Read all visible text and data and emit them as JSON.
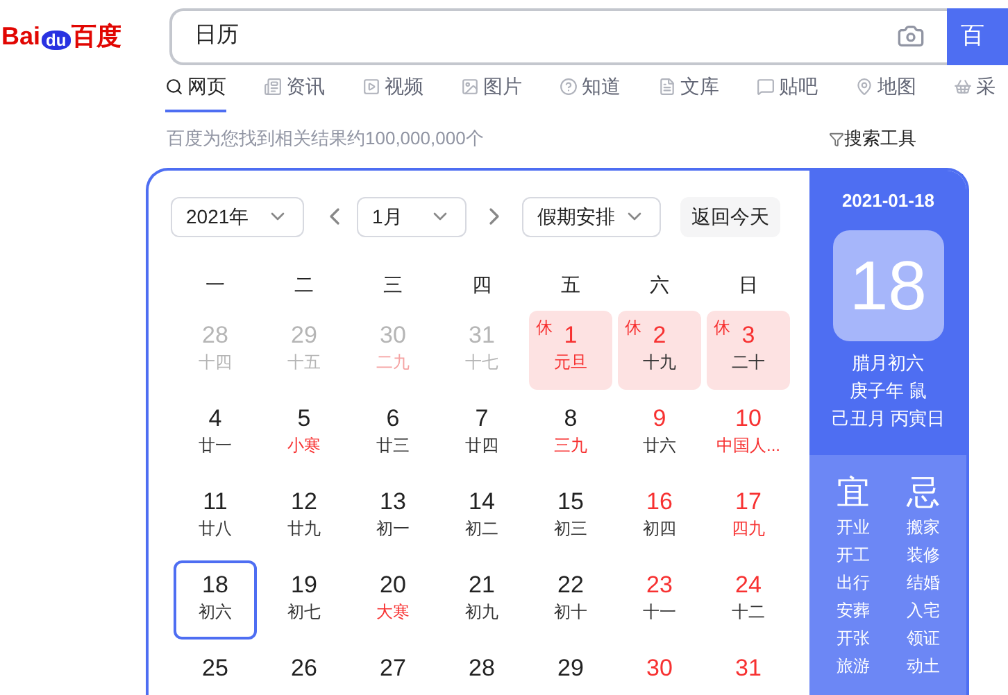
{
  "logo": {
    "left": "Bai",
    "paw": "du",
    "right": "百度"
  },
  "search": {
    "value": "日历",
    "button": "百"
  },
  "tabs": [
    {
      "label": "网页",
      "selected": true,
      "kind": "search"
    },
    {
      "label": "资讯",
      "selected": false,
      "kind": "news"
    },
    {
      "label": "视频",
      "selected": false,
      "kind": "video"
    },
    {
      "label": "图片",
      "selected": false,
      "kind": "image"
    },
    {
      "label": "知道",
      "selected": false,
      "kind": "question"
    },
    {
      "label": "文库",
      "selected": false,
      "kind": "doc"
    },
    {
      "label": "贴吧",
      "selected": false,
      "kind": "forum"
    },
    {
      "label": "地图",
      "selected": false,
      "kind": "map"
    },
    {
      "label": "采",
      "selected": false,
      "kind": "shop"
    }
  ],
  "result_count": "百度为您找到相关结果约100,000,000个",
  "search_tools": "搜索工具",
  "calendar": {
    "year": "2021年",
    "month": "1月",
    "holiday_select": "假期安排",
    "today_button": "返回今天",
    "weekdays": [
      "一",
      "二",
      "三",
      "四",
      "五",
      "六",
      "日"
    ],
    "days": [
      {
        "day": "28",
        "lunar": "十四",
        "other_month": true,
        "festival": false,
        "selected": false
      },
      {
        "day": "29",
        "lunar": "十五",
        "other_month": true,
        "festival": false,
        "selected": false
      },
      {
        "day": "30",
        "lunar": "二九",
        "other_month": true,
        "festival": true,
        "selected": false
      },
      {
        "day": "31",
        "lunar": "十七",
        "other_month": true,
        "festival": false,
        "selected": false
      },
      {
        "day": "1",
        "lunar": "元旦",
        "rest_label": "休",
        "other_month": false,
        "red": true,
        "festival": true,
        "selected": false
      },
      {
        "day": "2",
        "lunar": "十九",
        "rest_label": "休",
        "other_month": false,
        "red": true,
        "festival": false,
        "selected": false
      },
      {
        "day": "3",
        "lunar": "二十",
        "rest_label": "休",
        "other_month": false,
        "red": true,
        "festival": false,
        "selected": false
      },
      {
        "day": "4",
        "lunar": "廿一",
        "other_month": false,
        "red": false,
        "festival": false,
        "selected": false
      },
      {
        "day": "5",
        "lunar": "小寒",
        "other_month": false,
        "red": false,
        "festival": true,
        "selected": false
      },
      {
        "day": "6",
        "lunar": "廿三",
        "other_month": false,
        "red": false,
        "festival": false,
        "selected": false
      },
      {
        "day": "7",
        "lunar": "廿四",
        "other_month": false,
        "red": false,
        "festival": false,
        "selected": false
      },
      {
        "day": "8",
        "lunar": "三九",
        "other_month": false,
        "red": false,
        "festival": true,
        "selected": false
      },
      {
        "day": "9",
        "lunar": "廿六",
        "other_month": false,
        "red": true,
        "festival": false,
        "selected": false
      },
      {
        "day": "10",
        "lunar": "中国人...",
        "other_month": false,
        "red": true,
        "festival": true,
        "selected": false
      },
      {
        "day": "11",
        "lunar": "廿八",
        "other_month": false,
        "red": false,
        "festival": false,
        "selected": false
      },
      {
        "day": "12",
        "lunar": "廿九",
        "other_month": false,
        "red": false,
        "festival": false,
        "selected": false
      },
      {
        "day": "13",
        "lunar": "初一",
        "other_month": false,
        "red": false,
        "festival": false,
        "selected": false
      },
      {
        "day": "14",
        "lunar": "初二",
        "other_month": false,
        "red": false,
        "festival": false,
        "selected": false
      },
      {
        "day": "15",
        "lunar": "初三",
        "other_month": false,
        "red": false,
        "festival": false,
        "selected": false
      },
      {
        "day": "16",
        "lunar": "初四",
        "other_month": false,
        "red": true,
        "festival": false,
        "selected": false
      },
      {
        "day": "17",
        "lunar": "四九",
        "other_month": false,
        "red": true,
        "festival": true,
        "selected": false
      },
      {
        "day": "18",
        "lunar": "初六",
        "other_month": false,
        "red": false,
        "festival": false,
        "selected": true
      },
      {
        "day": "19",
        "lunar": "初七",
        "other_month": false,
        "red": false,
        "festival": false,
        "selected": false
      },
      {
        "day": "20",
        "lunar": "大寒",
        "other_month": false,
        "red": false,
        "festival": true,
        "selected": false
      },
      {
        "day": "21",
        "lunar": "初九",
        "other_month": false,
        "red": false,
        "festival": false,
        "selected": false
      },
      {
        "day": "22",
        "lunar": "初十",
        "other_month": false,
        "red": false,
        "festival": false,
        "selected": false
      },
      {
        "day": "23",
        "lunar": "十一",
        "other_month": false,
        "red": true,
        "festival": false,
        "selected": false
      },
      {
        "day": "24",
        "lunar": "十二",
        "other_month": false,
        "red": true,
        "festival": false,
        "selected": false
      },
      {
        "day": "25",
        "other_month": false,
        "red": false,
        "selected": false
      },
      {
        "day": "26",
        "other_month": false,
        "red": false,
        "selected": false
      },
      {
        "day": "27",
        "other_month": false,
        "red": false,
        "selected": false
      },
      {
        "day": "28",
        "other_month": false,
        "red": false,
        "selected": false
      },
      {
        "day": "29",
        "other_month": false,
        "red": false,
        "selected": false
      },
      {
        "day": "30",
        "other_month": false,
        "red": true,
        "selected": false
      },
      {
        "day": "31",
        "other_month": false,
        "red": true,
        "selected": false
      }
    ]
  },
  "detail": {
    "date": "2021-01-18",
    "day": "18",
    "lunar_lines": [
      "腊月初六",
      "庚子年 鼠",
      "己丑月 丙寅日"
    ],
    "good": {
      "title": "宜",
      "items": [
        "开业",
        "开工",
        "出行",
        "安葬",
        "开张",
        "旅游"
      ]
    },
    "bad": {
      "title": "忌",
      "items": [
        "搬家",
        "装修",
        "结婚",
        "入宅",
        "领证",
        "动土"
      ]
    }
  }
}
